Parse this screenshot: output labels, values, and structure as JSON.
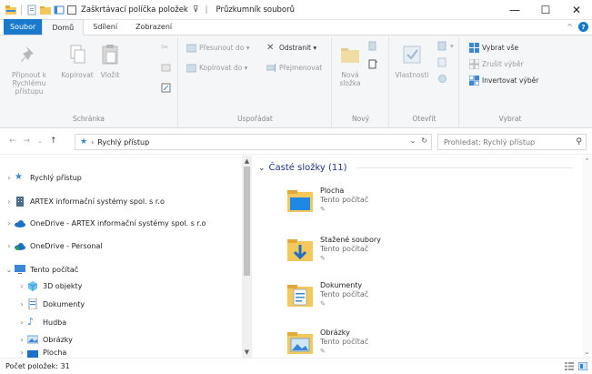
{
  "window": {
    "checkbox_label": "Zaškrtávací políčka položek",
    "app_title": "Průzkumník souborů",
    "title_separator": "|"
  },
  "tabs": [
    {
      "label": "Soubor"
    },
    {
      "label": "Domů"
    },
    {
      "label": "Sdílení"
    },
    {
      "label": "Zobrazení"
    }
  ],
  "ribbon": {
    "schranka": {
      "label": "Schránka",
      "pin": "Připnout k Rychlému přístupu",
      "copy": "Kopírovat",
      "paste": "Vložit"
    },
    "usporadat": {
      "label": "Uspořádat",
      "move_to": "Přesunout do ▾",
      "copy_to": "Kopírovat do ▾",
      "delete": "Odstranit ▾",
      "rename": "Přejmenovat"
    },
    "novy": {
      "label": "Nový",
      "new_folder": "Nová složka"
    },
    "otevrit": {
      "label": "Otevřít",
      "properties": "Vlastnosti"
    },
    "vybrat": {
      "label": "Vybrat",
      "select_all": "Vybrat vše",
      "select_none": "Zrušit výběr",
      "invert": "Invertovat výběr"
    }
  },
  "address": {
    "path": "Rychlý přístup",
    "separator": "›",
    "search_placeholder": "Prohledat: Rychlý přístup"
  },
  "navpane": {
    "items": [
      {
        "label": "Rychlý přístup",
        "icon": "star-icon"
      },
      {
        "label": "ARTEX informační systémy spol. s r.o",
        "icon": "building-icon"
      },
      {
        "label": "OneDrive - ARTEX informační systémy spol. s r.o",
        "icon": "cloud-icon"
      },
      {
        "label": "OneDrive - Personal",
        "icon": "cloud-icon"
      },
      {
        "label": "Tento počítač",
        "icon": "computer-icon"
      },
      {
        "label": "3D objekty",
        "icon": "cube-icon"
      },
      {
        "label": "Dokumenty",
        "icon": "document-icon"
      },
      {
        "label": "Hudba",
        "icon": "music-icon"
      },
      {
        "label": "Obrázky",
        "icon": "picture-icon"
      },
      {
        "label": "Plocha",
        "icon": "desktop-icon"
      }
    ]
  },
  "content": {
    "group_title": "Časté složky (11)",
    "folders": [
      {
        "name": "Plocha",
        "location": "Tento počítač",
        "icon": "desktop-folder-icon"
      },
      {
        "name": "Stažené soubory",
        "location": "Tento počítač",
        "icon": "downloads-folder-icon"
      },
      {
        "name": "Dokumenty",
        "location": "Tento počítač",
        "icon": "documents-folder-icon"
      },
      {
        "name": "Obrázky",
        "location": "Tento počítač",
        "icon": "pictures-folder-icon"
      }
    ]
  },
  "status": {
    "count": "Počet položek: 31"
  },
  "colors": {
    "accent": "#1979ca",
    "group_header": "#1e3287",
    "ribbon_bg": "#f5f6f7",
    "folder_yellow": "#f3c95b"
  }
}
